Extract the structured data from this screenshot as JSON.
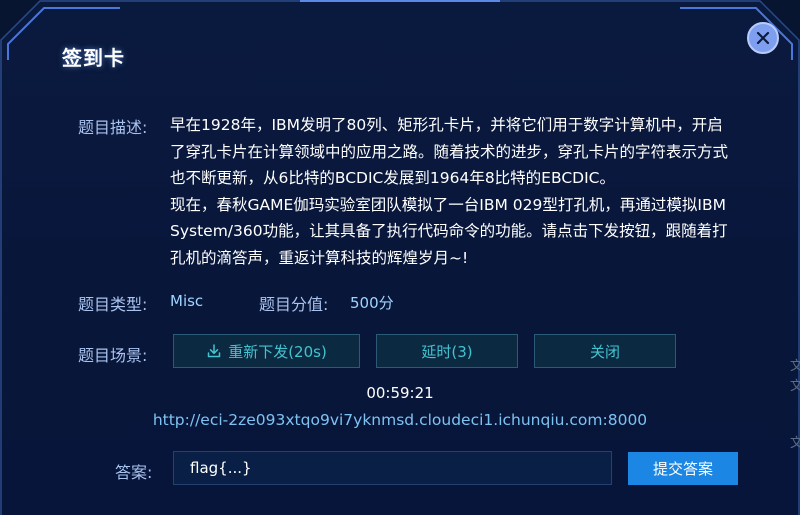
{
  "dialog": {
    "title": "签到卡",
    "close_icon": "close-icon"
  },
  "description": {
    "label": "题目描述:",
    "lines": [
      "早在1928年，IBM发明了80列、矩形孔卡片，并将它们用于数字计算机中，开启",
      "了穿孔卡片在计算领域中的应用之路。随着技术的进步，穿孔卡片的字符表示方式",
      "也不断更新，从6比特的BCDIC发展到1964年8比特的EBCDIC。",
      "现在，春秋GAME伽玛实验室团队模拟了一台IBM 029型打孔机，再通过模拟IBM",
      "System/360功能，让其具备了执行代码命令的功能。请点击下发按钮，跟随着打",
      "孔机的滴答声，重返计算科技的辉煌岁月~!"
    ]
  },
  "meta": {
    "type_label": "题目类型:",
    "type_value": "Misc",
    "score_label": "题目分值:",
    "score_value": "500分"
  },
  "scene": {
    "label": "题目场景:",
    "buttons": {
      "redeploy": "重新下发(20s)",
      "extend": "延时(3)",
      "close": "关闭"
    },
    "timer": "00:59:21",
    "url": "http://eci-2ze093xtqo9vi7yknmsd.cloudeci1.ichunqiu.com:8000"
  },
  "answer": {
    "label": "答案:",
    "value": "flag{...}",
    "submit_label": "提交答案"
  },
  "colors": {
    "background": "#08163a",
    "accent": "#1b86e3",
    "teal_button_text": "#44c2cf",
    "label": "#aac3ee"
  },
  "edge_glyph": "文"
}
